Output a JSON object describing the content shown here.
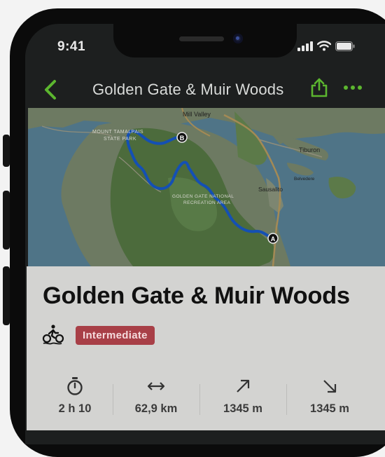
{
  "status_bar": {
    "time": "9:41"
  },
  "nav": {
    "title": "Golden Gate & Muir Woods"
  },
  "map": {
    "labels": {
      "mill_valley": "Mill Valley",
      "mount_tam": "MOUNT TAMALPAIS",
      "state_park": "STATE PARK",
      "tiburon": "Tiburon",
      "belvedere": "Belvedere",
      "sausalito": "Sausalito",
      "gg_line1": "GOLDEN GATE NATIONAL",
      "gg_line2": "RECREATION AREA"
    },
    "start_marker": "A",
    "end_marker": "B"
  },
  "trail": {
    "title": "Golden Gate & Muir Woods",
    "activity_icon": "cycling-icon",
    "difficulty": "Intermediate"
  },
  "stats": [
    {
      "icon": "stopwatch-icon",
      "value": "2 h 10"
    },
    {
      "icon": "distance-arrows-icon",
      "value": "62,9 km"
    },
    {
      "icon": "ascent-arrow-icon",
      "value": "1345 m"
    },
    {
      "icon": "descent-arrow-icon",
      "value": "1345 m"
    }
  ],
  "colors": {
    "accent_green": "#5cb62f",
    "route_blue": "#1450b4",
    "difficulty_badge": "#a83f47"
  }
}
